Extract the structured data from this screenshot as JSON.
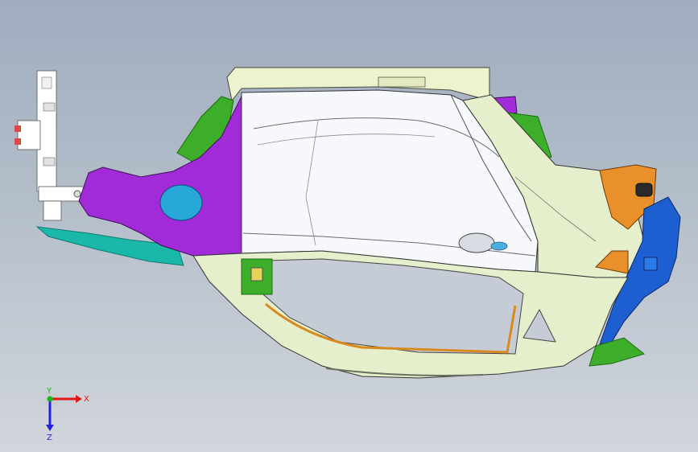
{
  "viewport": {
    "background_top": "#9fadbf",
    "background_bottom": "#d2d6dc"
  },
  "model": {
    "parts": [
      {
        "name": "roof-rail-panel",
        "color": "#eef3cf"
      },
      {
        "name": "body-side-outer-white",
        "color": "#f7f8fc"
      },
      {
        "name": "wheelhouse-outer-purple",
        "color": "#a22bd9"
      },
      {
        "name": "rear-pillar-panel",
        "color": "#e6efcb"
      },
      {
        "name": "sill-lower-panel",
        "color": "#e6efcb"
      },
      {
        "name": "rear-bracket-orange",
        "color": "#e9902a"
      },
      {
        "name": "rear-lamp-mount-blue",
        "color": "#1d5fd0"
      },
      {
        "name": "front-bracket-green",
        "color": "#3cae2a"
      },
      {
        "name": "lower-trim-cyan",
        "color": "#1ab8a8"
      },
      {
        "name": "front-stiffener-white",
        "color": "#ffffff"
      }
    ]
  },
  "triad": {
    "x_label": "X",
    "y_label": "Y",
    "z_label": "Z",
    "x_color": "#e01818",
    "y_color": "#18b818",
    "z_color": "#2222d8"
  }
}
